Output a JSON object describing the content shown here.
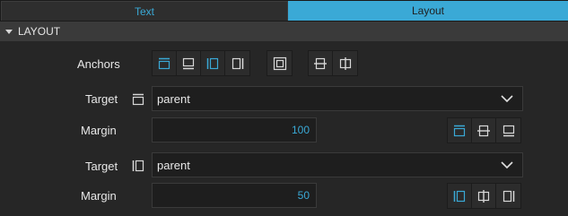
{
  "tabs": [
    {
      "label": "Text",
      "active": false
    },
    {
      "label": "Layout",
      "active": true
    }
  ],
  "section": {
    "title": "LAYOUT",
    "expanded": true
  },
  "anchors": {
    "label": "Anchors",
    "buttons": [
      {
        "name": "anchor-top",
        "icon": "anchor-top-icon",
        "active": true
      },
      {
        "name": "anchor-bottom",
        "icon": "anchor-bottom-icon",
        "active": false
      },
      {
        "name": "anchor-left",
        "icon": "anchor-left-icon",
        "active": true
      },
      {
        "name": "anchor-right",
        "icon": "anchor-right-icon",
        "active": false
      },
      {
        "name": "anchor-fill",
        "icon": "anchor-fill-icon",
        "active": false
      },
      {
        "name": "anchor-vertical-center",
        "icon": "anchor-vertical-center-icon",
        "active": false
      },
      {
        "name": "anchor-horizontal-center",
        "icon": "anchor-horizontal-center-icon",
        "active": false
      }
    ]
  },
  "vertical_anchor": {
    "target_label": "Target",
    "target_value": "parent",
    "margin_label": "Margin",
    "margin_value": "100",
    "align_buttons": [
      "align-top-icon",
      "align-vertical-center-icon",
      "align-bottom-icon"
    ],
    "active_align": "align-top-icon"
  },
  "horizontal_anchor": {
    "target_label": "Target",
    "target_value": "parent",
    "margin_label": "Margin",
    "margin_value": "50",
    "align_buttons": [
      "align-left-icon",
      "align-horizontal-center-icon",
      "align-right-icon"
    ],
    "active_align": "align-left-icon"
  },
  "colors": {
    "accent": "#3aa9d6",
    "icon": "#d8d8d8",
    "background": "#262626",
    "header": "#3a3a3a"
  }
}
